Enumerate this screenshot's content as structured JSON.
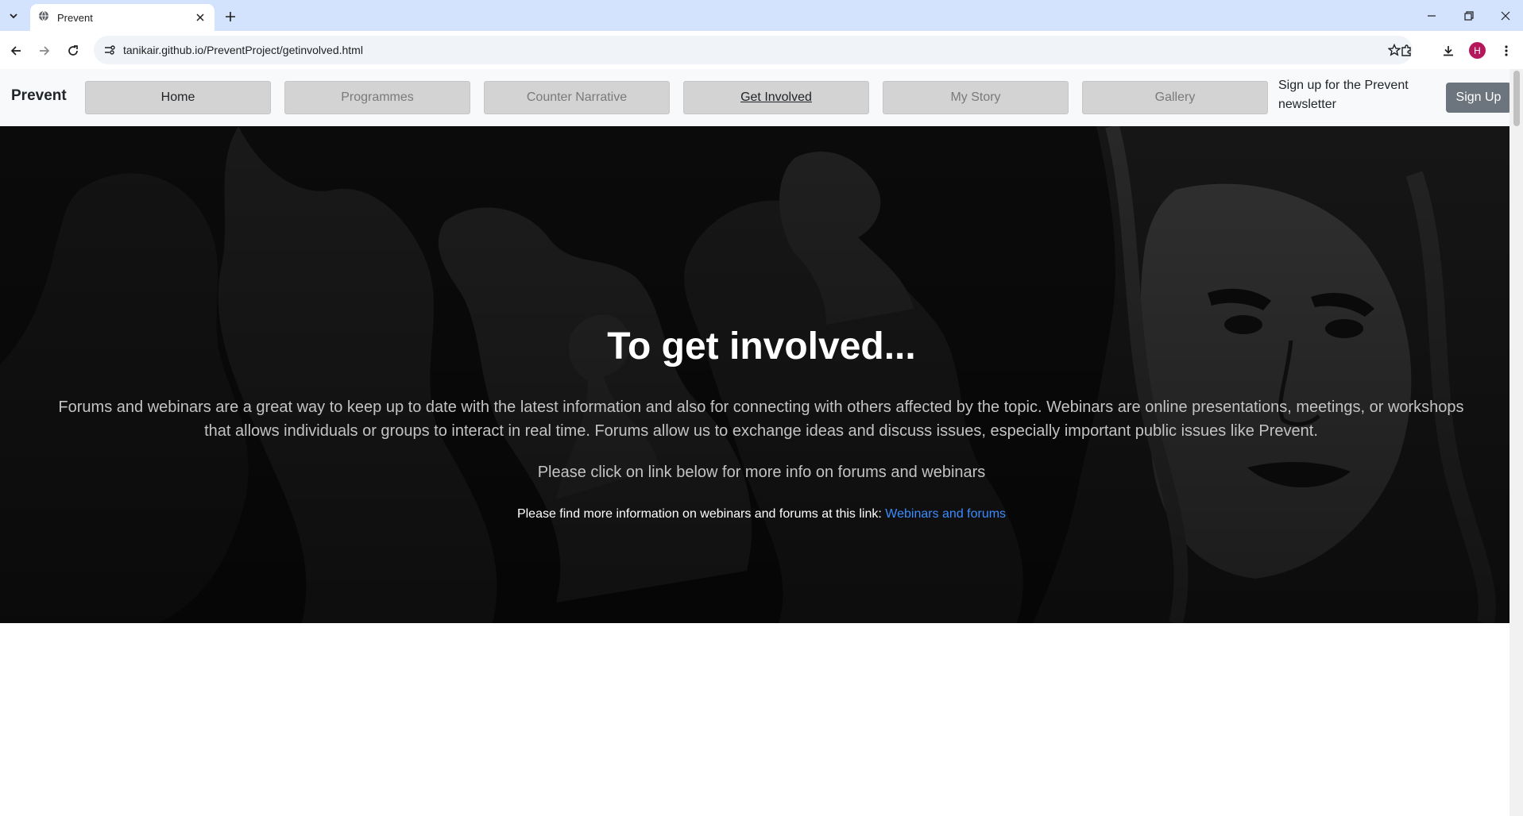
{
  "browser": {
    "tab_title": "Prevent",
    "url": "tanikair.github.io/PreventProject/getinvolved.html",
    "profile_initial": "H",
    "icons": [
      "tab-search-icon",
      "globe-icon",
      "close-icon",
      "plus-icon",
      "minimize-icon",
      "restore-icon",
      "close-window-icon",
      "back-icon",
      "forward-icon",
      "reload-icon",
      "site-info-icon",
      "star-icon",
      "extensions-icon",
      "download-icon",
      "menu-icon"
    ]
  },
  "navbar": {
    "brand": "Prevent",
    "links": [
      {
        "label": "Home"
      },
      {
        "label": "Programmes"
      },
      {
        "label": "Counter Narrative"
      },
      {
        "label": "Get Involved"
      },
      {
        "label": "My Story"
      },
      {
        "label": "Gallery"
      }
    ],
    "signup_text": "Sign up for the Prevent newsletter",
    "signup_button": "Sign Up"
  },
  "hero": {
    "title": "To get involved...",
    "body": "Forums and webinars are a great way to keep up to date with the latest information and also for connecting with others affected by the topic. Webinars are online presentations, meetings, or workshops that allows individuals or groups to interact in real time. Forums allow us to exchange ideas and discuss issues, especially important public issues like Prevent.",
    "click_text": "Please click on link below for more info on forums and webinars",
    "more_text": "Please find more information on webinars and forums at this link:",
    "link_text": "Webinars and forums"
  },
  "colors": {
    "tabstrip": "#d3e3fd",
    "navbar_bg": "#f8f9fa",
    "nav_button": "#d3d3d3",
    "signup_button": "#6c757d",
    "hero_bg": "#0c0c0c",
    "link": "#3b8cff"
  }
}
